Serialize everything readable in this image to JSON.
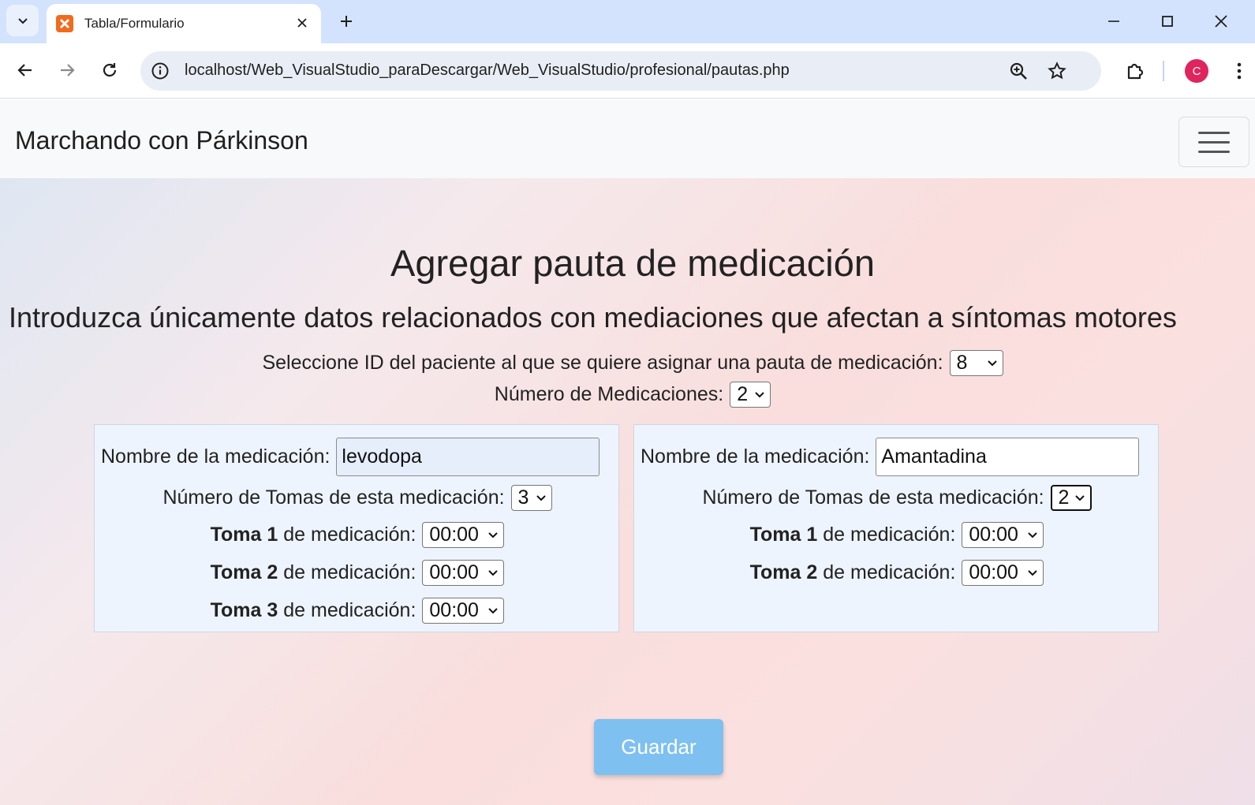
{
  "browser": {
    "tab_title": "Tabla/Formulario",
    "url": "localhost/Web_VisualStudio_paraDescargar/Web_VisualStudio/profesional/pautas.php",
    "avatar_letter": "C"
  },
  "navbar": {
    "brand": "Marchando con Párkinson"
  },
  "main": {
    "title": "Agregar pauta de medicación",
    "subtitle": "Introduzca únicamente datos relacionados con mediaciones que afectan a síntomas motores",
    "patient_label": "Seleccione ID del paciente al que se quiere asignar una pauta de medicación:",
    "patient_value": "8",
    "num_meds_label": "Número de Medicaciones:",
    "num_meds_value": "2"
  },
  "medications": [
    {
      "name_label": "Nombre de la medicación:",
      "name_value": "levodopa",
      "doses_label": "Número de Tomas de esta medicación:",
      "doses_value": "3",
      "doses": [
        {
          "bold": "Toma 1",
          "rest": "de medicación:",
          "time": "00:00"
        },
        {
          "bold": "Toma 2",
          "rest": "de medicación:",
          "time": "00:00"
        },
        {
          "bold": "Toma 3",
          "rest": "de medicación:",
          "time": "00:00"
        }
      ]
    },
    {
      "name_label": "Nombre de la medicación:",
      "name_value": "Amantadina",
      "doses_label": "Número de Tomas de esta medicación:",
      "doses_value": "2",
      "doses": [
        {
          "bold": "Toma 1",
          "rest": "de medicación:",
          "time": "00:00"
        },
        {
          "bold": "Toma 2",
          "rest": "de medicación:",
          "time": "00:00"
        }
      ]
    }
  ],
  "save_button": "Guardar",
  "colors": {
    "accent_button": "#7ec0f0",
    "tab_bar": "#d3e3fd",
    "avatar": "#e0245e",
    "favicon": "#f26b1d"
  }
}
